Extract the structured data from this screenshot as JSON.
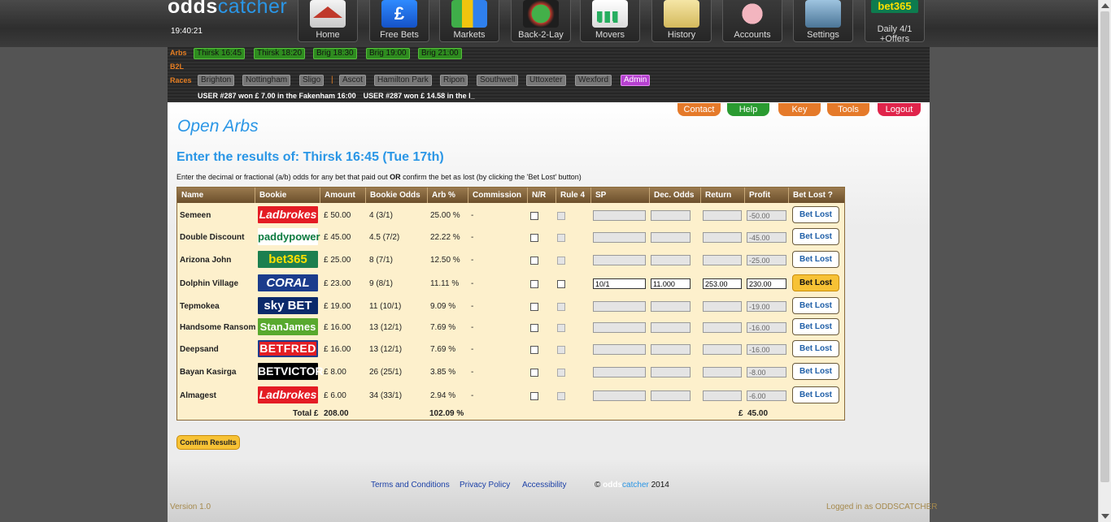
{
  "header": {
    "logo_a": "odds",
    "logo_b": "catcher",
    "clock": "19:40:21",
    "nav": {
      "home": "Home",
      "freebets": "Free Bets",
      "freebets_symbol": "£",
      "markets": "Markets",
      "back2lay": "Back-2-Lay",
      "movers": "Market Movers",
      "history": "History",
      "accounts": "Accounts",
      "settings": "Settings",
      "bet365_brand": "bet365",
      "bet365_line1": "Daily 4/1",
      "bet365_line2": "+Offers"
    }
  },
  "ticker": {
    "arbs_label": "Arbs",
    "b2l_label": "B2L",
    "races_label": "Races",
    "arbs": [
      "Thirsk 16:45",
      "Thirsk 18:20",
      "Brig 18:30",
      "Brig 19:00",
      "Brig 21:00"
    ],
    "races": [
      "Brighton",
      "Nottingham",
      "Sligo",
      "Ascot",
      "Hamilton Park",
      "Ripon",
      "Southwell",
      "Uttoxeter",
      "Wexford",
      "Admin"
    ],
    "race_separator": "|",
    "messages": [
      "USER #287 won £ 7.00 in the Fakenham 16:00",
      "USER #287 won £ 14.58 in the I_"
    ]
  },
  "top_buttons": {
    "contact": "Contact",
    "help": "Help",
    "key": "Key",
    "tools": "Tools",
    "logout": "Logout"
  },
  "colors": {
    "accent": "#2a96e6",
    "orange": "#e57a2a",
    "green": "#2a9b31",
    "red": "#e0244b",
    "yellow": "#f7c235"
  },
  "page": {
    "title": "Open Arbs",
    "subheading": "Enter the results of: Thirsk 16:45 (Tue 17th)",
    "instruction_a": "Enter the decimal or fractional (a/b) odds for any bet that paid out ",
    "instruction_b": "OR",
    "instruction_c": " confirm the bet as lost (by clicking the 'Bet Lost' button)"
  },
  "table": {
    "columns": [
      "Name",
      "Bookie",
      "Amount",
      "Bookie Odds",
      "Arb %",
      "Commission",
      "N/R",
      "Rule 4",
      "SP",
      "Dec. Odds",
      "Return",
      "Profit",
      "Bet Lost ?"
    ],
    "rows": [
      {
        "name": "Semeen",
        "bookie": "Ladbrokes",
        "amount": "£ 50.00",
        "odds": "4 (3/1)",
        "arb": "25.00 %",
        "commission": "-",
        "sp": "",
        "dec": "",
        "ret": "",
        "profit": "-50.00",
        "action": "Bet Lost"
      },
      {
        "name": "Double Discount",
        "bookie": "paddypower",
        "amount": "£ 45.00",
        "odds": "4.5 (7/2)",
        "arb": "22.22 %",
        "commission": "-",
        "sp": "",
        "dec": "",
        "ret": "",
        "profit": "-45.00",
        "action": "Bet Lost"
      },
      {
        "name": "Arizona John",
        "bookie": "bet365",
        "amount": "£ 25.00",
        "odds": "8 (7/1)",
        "arb": "12.50 %",
        "commission": "-",
        "sp": "",
        "dec": "",
        "ret": "",
        "profit": "-25.00",
        "action": "Bet Lost"
      },
      {
        "name": "Dolphin Village",
        "bookie": "CORAL",
        "amount": "£ 23.00",
        "odds": "9 (8/1)",
        "arb": "11.11 %",
        "commission": "-",
        "sp": "10/1",
        "dec": "11.000",
        "ret": "253.00",
        "profit": "230.00",
        "action": "Bet Lost"
      },
      {
        "name": "Tepmokea",
        "bookie": "sky BET",
        "amount": "£ 19.00",
        "odds": "11 (10/1)",
        "arb": "9.09 %",
        "commission": "-",
        "sp": "",
        "dec": "",
        "ret": "",
        "profit": "-19.00",
        "action": "Bet Lost"
      },
      {
        "name": "Handsome Ransom",
        "bookie": "StanJames",
        "amount": "£ 16.00",
        "odds": "13 (12/1)",
        "arb": "7.69 %",
        "commission": "-",
        "sp": "",
        "dec": "",
        "ret": "",
        "profit": "-16.00",
        "action": "Bet Lost"
      },
      {
        "name": "Deepsand",
        "bookie": "BETFRED",
        "amount": "£ 16.00",
        "odds": "13 (12/1)",
        "arb": "7.69 %",
        "commission": "-",
        "sp": "",
        "dec": "",
        "ret": "",
        "profit": "-16.00",
        "action": "Bet Lost"
      },
      {
        "name": "Bayan Kasirga",
        "bookie": "BETVICTOR",
        "amount": "£ 8.00",
        "odds": "26 (25/1)",
        "arb": "3.85 %",
        "commission": "-",
        "sp": "",
        "dec": "",
        "ret": "",
        "profit": "-8.00",
        "action": "Bet Lost"
      },
      {
        "name": "Almagest",
        "bookie": "Ladbrokes",
        "amount": "£ 6.00",
        "odds": "34 (33/1)",
        "arb": "2.94 %",
        "commission": "-",
        "sp": "",
        "dec": "",
        "ret": "",
        "profit": "-6.00",
        "action": "Bet Lost"
      }
    ],
    "totals": {
      "label": "Total £",
      "amount": "208.00",
      "arb": "102.09 %",
      "profit_currency": "£",
      "profit": "45.00"
    }
  },
  "confirm_button": "Confirm Results",
  "footer": {
    "terms": "Terms and Conditions",
    "privacy": "Privacy Policy",
    "accessibility": "Accessibility",
    "copyright_a": "© ",
    "copyright_brand_a": "odds",
    "copyright_brand_b": "catcher",
    "copyright_year": " 2014",
    "version": "Version 1.0",
    "logged_in": "Logged in as ODDSCATCHER"
  }
}
